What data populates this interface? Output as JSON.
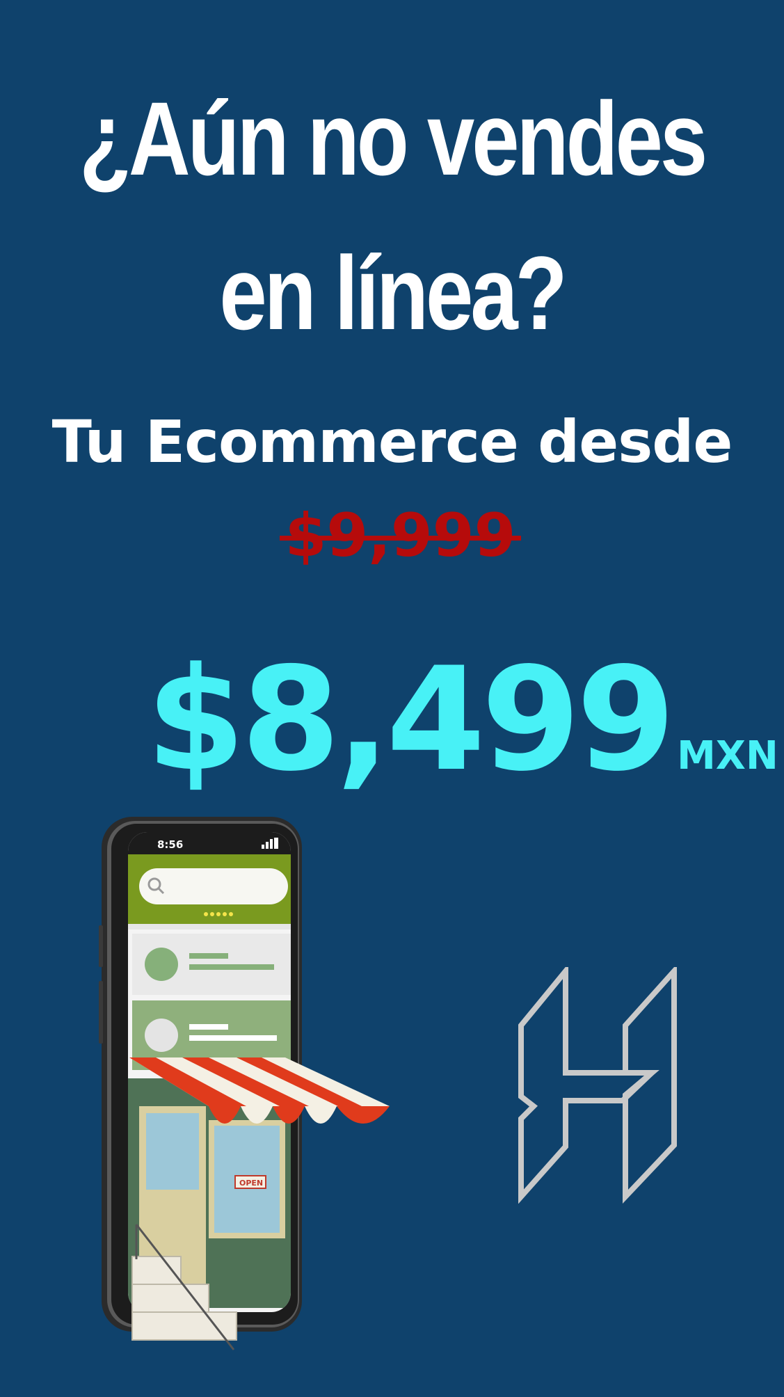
{
  "headline": {
    "line1": "¿Aún no vendes",
    "line2": "en línea?"
  },
  "subtitle": "Tu Ecommerce desde",
  "pricing": {
    "old_price": "$9,999",
    "new_price": "$8,499",
    "currency": "MXN"
  },
  "phone": {
    "status_time": "8:56",
    "store_sign": "OPEN"
  },
  "colors": {
    "background": "#0f426c",
    "headline_text": "#ffffff",
    "old_price": "#b60b0b",
    "new_price": "#48f1f6",
    "logo_stroke": "#c9c9c9",
    "app_bar": "#7a9a1f",
    "card_green": "#8fb07c",
    "awning_red": "#e03b1c"
  },
  "icons": {
    "search": "search-icon",
    "signal": "signal-icon",
    "logo": "brand-h-logo"
  }
}
